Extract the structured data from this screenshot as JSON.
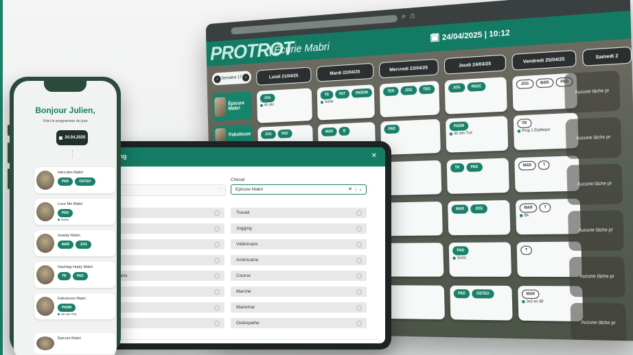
{
  "monitor": {
    "brand": "PROTROT",
    "stable": "| Écurie Mabri",
    "datetime": "24/04/2025 | 10:12",
    "week": "Semaine 17",
    "days": [
      "Lundi 21/04/25",
      "Mardi 22/04/25",
      "Mercredi 23/04/25",
      "Jeudi 24/04/25",
      "Vendredi 25/04/25",
      "Samedi 2"
    ],
    "horses": [
      "Épicure Mabri",
      "Fabuleuse"
    ],
    "cells": [
      {
        "tags": [
          {
            "t": "JOG",
            "s": "g"
          }
        ],
        "note": "45 min"
      },
      {
        "tags": [
          {
            "t": "TR",
            "s": "g"
          },
          {
            "t": "PAT",
            "s": "g"
          },
          {
            "t": "PADDM",
            "s": "g"
          }
        ],
        "note": "Sortie"
      },
      {
        "tags": [
          {
            "t": "TER",
            "s": "g"
          },
          {
            "t": "JOG",
            "s": "g"
          },
          {
            "t": "TRO",
            "s": "g"
          }
        ],
        "note": ""
      },
      {
        "tags": [
          {
            "t": "JOG",
            "s": "g"
          },
          {
            "t": "PADC",
            "s": "g"
          }
        ],
        "note": ""
      },
      {
        "tags": [
          {
            "t": "JOG",
            "s": "o"
          },
          {
            "t": "MAR",
            "s": "o"
          },
          {
            "t": "PAD",
            "s": "o"
          }
        ],
        "note": ""
      },
      {
        "tags": [
          {
            "t": "JOG",
            "s": "g"
          },
          {
            "t": "PAD",
            "s": "g"
          }
        ],
        "note": ""
      },
      {
        "tags": [
          {
            "t": "MAR",
            "s": "g"
          },
          {
            "t": "B",
            "s": "g"
          }
        ],
        "note": ""
      },
      {
        "tags": [
          {
            "t": "PAD",
            "s": "g"
          }
        ],
        "note": ""
      },
      {
        "tags": [
          {
            "t": "PADM",
            "s": "g"
          }
        ],
        "note": "45 min Trot"
      },
      {
        "tags": [
          {
            "t": "TR",
            "s": "o"
          }
        ],
        "note": "Prog 1 Étalhique"
      },
      {
        "tags": [
          {
            "t": "TR",
            "s": "g"
          },
          {
            "t": "PAD",
            "s": "g"
          }
        ],
        "note": ""
      },
      {
        "tags": [
          {
            "t": "MAR",
            "s": "o"
          },
          {
            "t": "T",
            "s": "o"
          }
        ],
        "note": ""
      },
      {
        "tags": [
          {
            "t": "MAR",
            "s": "g"
          },
          {
            "t": "JOG",
            "s": "g"
          }
        ],
        "note": ""
      },
      {
        "tags": [
          {
            "t": "MAR",
            "s": "o"
          },
          {
            "t": "T",
            "s": "o"
          }
        ],
        "note": "Bk"
      },
      {
        "tags": [
          {
            "t": "PAD",
            "s": "g"
          }
        ],
        "note": "Soins"
      },
      {
        "tags": [
          {
            "t": "T",
            "s": "o"
          }
        ],
        "note": ""
      },
      {
        "tags": [
          {
            "t": "PAD",
            "s": "g"
          },
          {
            "t": "OSTEO",
            "s": "g"
          }
        ],
        "note": ""
      },
      {
        "tags": [
          {
            "t": "MAR",
            "s": "o"
          }
        ],
        "note": "3x3 en 48'"
      }
    ],
    "aucune": "Aucune tâche pr"
  },
  "tablet": {
    "title": "ing",
    "cheval_label": "Cheval",
    "cheval_value": "Epicure Mabri",
    "right_items": [
      "Travail",
      "Jogging",
      "Vétérinaire",
      "Américaine",
      "Course",
      "Marché",
      "Maréchal",
      "Ostéopathe"
    ],
    "left_items": [
      "",
      "",
      "",
      "",
      "ans",
      "",
      "",
      ""
    ]
  },
  "phone": {
    "greeting": "Bonjour Julien,",
    "subtitle": "Voici le programme du jour",
    "date": "24.04.2025",
    "horses": [
      {
        "name": "Hercules Mabri",
        "tags": [
          {
            "t": "PAD",
            "s": "g"
          },
          {
            "t": "OSTEO",
            "s": "g"
          }
        ],
        "note": ""
      },
      {
        "name": "Love Me Mabri",
        "tags": [
          {
            "t": "PAD",
            "s": "g"
          }
        ],
        "note": "Soins"
      },
      {
        "name": "Gatsby Mabri",
        "tags": [
          {
            "t": "MAR",
            "s": "g"
          },
          {
            "t": "JOG",
            "s": "g"
          }
        ],
        "note": ""
      },
      {
        "name": "Hashtag Hoply Mabri",
        "tags": [
          {
            "t": "TR",
            "s": "g"
          },
          {
            "t": "PAD",
            "s": "g"
          }
        ],
        "note": ""
      },
      {
        "name": "Fabuleuse Mabri",
        "tags": [
          {
            "t": "PADM",
            "s": "g"
          }
        ],
        "note": "45 min Trot"
      }
    ],
    "last": "Épicure Mabri"
  }
}
